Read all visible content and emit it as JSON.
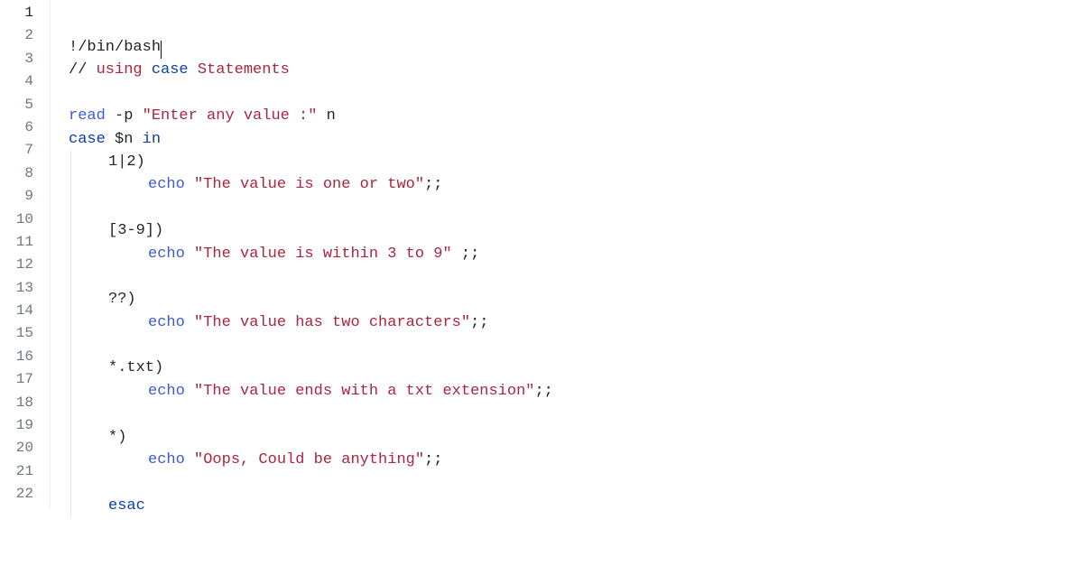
{
  "editor": {
    "lineNumbers": [
      "1",
      "2",
      "3",
      "4",
      "5",
      "6",
      "7",
      "8",
      "9",
      "10",
      "11",
      "12",
      "13",
      "14",
      "15",
      "16",
      "17",
      "18",
      "19",
      "20",
      "21",
      "22"
    ],
    "activeLine": 1,
    "cursor": {
      "line": 1,
      "afterToken": "shebang"
    },
    "lines": [
      {
        "indent": 0,
        "tokens": [
          {
            "t": "!/bin/bash",
            "cls": "tok-plain",
            "id": "shebang"
          }
        ]
      },
      {
        "indent": 0,
        "tokens": [
          {
            "t": "// ",
            "cls": "tok-plain"
          },
          {
            "t": "using",
            "cls": "tok-comment"
          },
          {
            "t": " ",
            "cls": "tok-plain"
          },
          {
            "t": "case",
            "cls": "tok-kw"
          },
          {
            "t": " ",
            "cls": "tok-plain"
          },
          {
            "t": "Statements",
            "cls": "tok-comment"
          }
        ]
      },
      {
        "indent": 0,
        "tokens": []
      },
      {
        "indent": 0,
        "tokens": [
          {
            "t": "read",
            "cls": "tok-cmd"
          },
          {
            "t": " -p ",
            "cls": "tok-plain"
          },
          {
            "t": "\"Enter any value :\"",
            "cls": "tok-str"
          },
          {
            "t": " n",
            "cls": "tok-plain"
          }
        ]
      },
      {
        "indent": 0,
        "tokens": [
          {
            "t": "case",
            "cls": "tok-kw"
          },
          {
            "t": " $n ",
            "cls": "tok-plain"
          },
          {
            "t": "in",
            "cls": "tok-kw"
          }
        ]
      },
      {
        "indent": 1,
        "tokens": [
          {
            "t": "1|2)",
            "cls": "tok-plain"
          }
        ]
      },
      {
        "indent": 2,
        "tokens": [
          {
            "t": "echo",
            "cls": "tok-cmd"
          },
          {
            "t": " ",
            "cls": "tok-plain"
          },
          {
            "t": "\"The value is one or two\"",
            "cls": "tok-str"
          },
          {
            "t": ";;",
            "cls": "tok-plain"
          }
        ]
      },
      {
        "indent": 1,
        "tokens": []
      },
      {
        "indent": 1,
        "tokens": [
          {
            "t": "[3-9])",
            "cls": "tok-plain"
          }
        ]
      },
      {
        "indent": 2,
        "tokens": [
          {
            "t": "echo",
            "cls": "tok-cmd"
          },
          {
            "t": " ",
            "cls": "tok-plain"
          },
          {
            "t": "\"The value is within 3 to 9\"",
            "cls": "tok-str"
          },
          {
            "t": " ;;",
            "cls": "tok-plain"
          }
        ]
      },
      {
        "indent": 1,
        "tokens": []
      },
      {
        "indent": 1,
        "tokens": [
          {
            "t": "??)",
            "cls": "tok-plain"
          }
        ]
      },
      {
        "indent": 2,
        "tokens": [
          {
            "t": "echo",
            "cls": "tok-cmd"
          },
          {
            "t": " ",
            "cls": "tok-plain"
          },
          {
            "t": "\"The value has two characters\"",
            "cls": "tok-str"
          },
          {
            "t": ";;",
            "cls": "tok-plain"
          }
        ]
      },
      {
        "indent": 1,
        "tokens": []
      },
      {
        "indent": 1,
        "tokens": [
          {
            "t": "*.txt)",
            "cls": "tok-plain"
          }
        ]
      },
      {
        "indent": 2,
        "tokens": [
          {
            "t": "echo",
            "cls": "tok-cmd"
          },
          {
            "t": " ",
            "cls": "tok-plain"
          },
          {
            "t": "\"The value ends with a txt extension\"",
            "cls": "tok-str"
          },
          {
            "t": ";;",
            "cls": "tok-plain"
          }
        ]
      },
      {
        "indent": 1,
        "tokens": []
      },
      {
        "indent": 1,
        "tokens": [
          {
            "t": "*)",
            "cls": "tok-plain"
          }
        ]
      },
      {
        "indent": 2,
        "tokens": [
          {
            "t": "echo",
            "cls": "tok-cmd"
          },
          {
            "t": " ",
            "cls": "tok-plain"
          },
          {
            "t": "\"Oops, Could be anything\"",
            "cls": "tok-str"
          },
          {
            "t": ";;",
            "cls": "tok-plain"
          }
        ]
      },
      {
        "indent": 1,
        "tokens": []
      },
      {
        "indent": 1,
        "tokens": [
          {
            "t": "esac",
            "cls": "tok-kw"
          }
        ]
      },
      {
        "indent": 0,
        "tokens": []
      }
    ]
  }
}
